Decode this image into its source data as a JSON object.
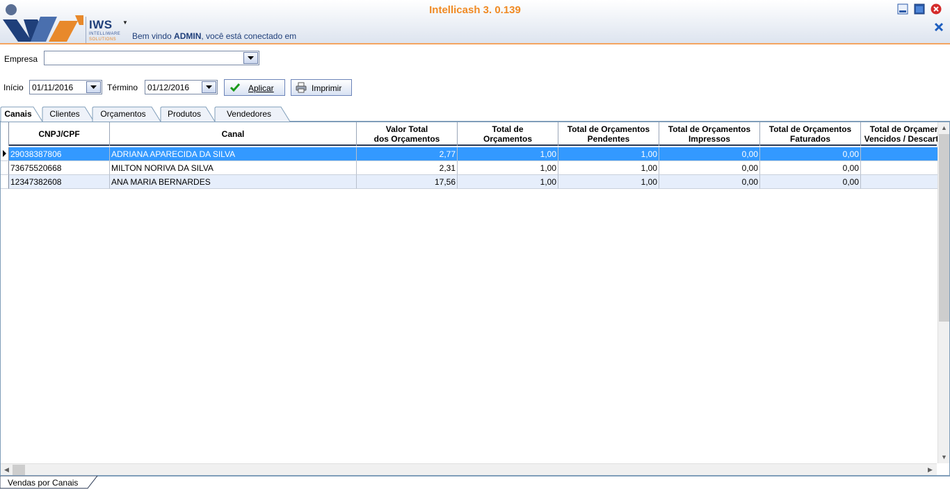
{
  "window": {
    "title": "Intellicash 3. 0.139",
    "welcome_prefix": "Bem vindo",
    "welcome_user": "ADMIN",
    "welcome_suffix": ", você está conectado em"
  },
  "logo": {
    "name": "IWS",
    "line1": "INTELLIWARE",
    "line2": "SOLUTIONS"
  },
  "filters": {
    "empresa_label": "Empresa",
    "empresa_value": "",
    "inicio_label": "Início",
    "inicio_value": "01/11/2016",
    "termino_label": "Término",
    "termino_value": "01/12/2016",
    "aplicar_label": "Aplicar",
    "imprimir_label": "Imprimir"
  },
  "tabs": [
    "Canais",
    "Clientes",
    "Orçamentos",
    "Produtos",
    "Vendedores"
  ],
  "active_tab": "Canais",
  "grid": {
    "columns": [
      {
        "l1": "CNPJ/CPF",
        "l2": ""
      },
      {
        "l1": "Canal",
        "l2": ""
      },
      {
        "l1": "Valor Total",
        "l2": "dos Orçamentos"
      },
      {
        "l1": "Total de",
        "l2": "Orçamentos"
      },
      {
        "l1": "Total de Orçamentos",
        "l2": "Pendentes"
      },
      {
        "l1": "Total de Orçamentos",
        "l2": "Impressos"
      },
      {
        "l1": "Total de Orçamentos",
        "l2": "Faturados"
      },
      {
        "l1": "Total de Orçamentos",
        "l2": "Vencidos / Descartados"
      }
    ],
    "rows": [
      {
        "cnpj": "29038387806",
        "canal": "ADRIANA APARECIDA DA SILVA",
        "valor": "2,77",
        "total": "1,00",
        "pendentes": "1,00",
        "impressos": "0,00",
        "faturados": "0,00",
        "vencidos": ""
      },
      {
        "cnpj": "73675520668",
        "canal": "MILTON NORIVA DA SILVA",
        "valor": "2,31",
        "total": "1,00",
        "pendentes": "1,00",
        "impressos": "0,00",
        "faturados": "0,00",
        "vencidos": ""
      },
      {
        "cnpj": "12347382608",
        "canal": "ANA MARIA BERNARDES",
        "valor": "17,56",
        "total": "1,00",
        "pendentes": "1,00",
        "impressos": "0,00",
        "faturados": "0,00",
        "vencidos": ""
      }
    ]
  },
  "bottom_tab": "Vendas por Canais",
  "colors": {
    "title": "#f08a24",
    "selected_row": "#3399ff",
    "alt_row": "#e6eefb",
    "header_accent": "#f4a460"
  }
}
